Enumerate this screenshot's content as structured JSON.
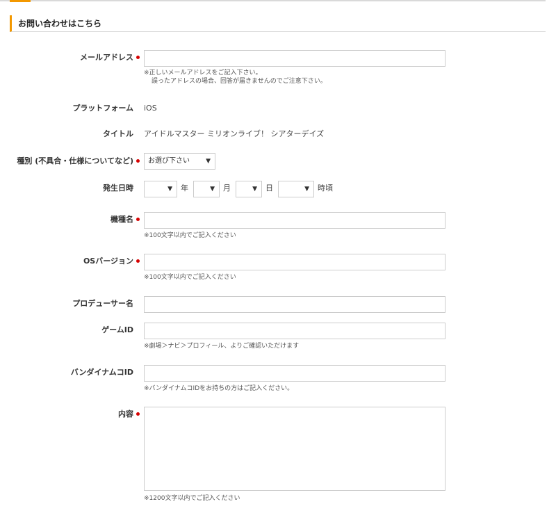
{
  "form": {
    "title": "お問い合わせはこちら",
    "email": {
      "label": "メールアドレス",
      "value": "",
      "note1": "※正しいメールアドレスをご記入下さい。",
      "note2": "誤ったアドレスの場合、回答が届きませんのでご注意下さい。"
    },
    "platform": {
      "label": "プラットフォーム",
      "value": "iOS"
    },
    "title_field": {
      "label": "タイトル",
      "value": "アイドルマスター ミリオンライブ！ シアターデイズ"
    },
    "category": {
      "label": "種別 (不具合・仕様についてなど)",
      "selected": "お選び下さい"
    },
    "occurrence": {
      "label": "発生日時",
      "year_unit": "年",
      "month_unit": "月",
      "day_unit": "日",
      "hour_unit": "時頃"
    },
    "model": {
      "label": "機種名",
      "value": "",
      "note": "※100文字以内でご記入ください"
    },
    "os_version": {
      "label": "OSバージョン",
      "value": "",
      "note": "※100文字以内でご記入ください"
    },
    "producer_name": {
      "label": "プロデューサー名",
      "value": ""
    },
    "game_id": {
      "label": "ゲームID",
      "value": "",
      "note": "※劇場＞ナビ＞プロフィール、よりご確認いただけます"
    },
    "bandai_id": {
      "label": "バンダイナムコID",
      "value": "",
      "note": "※バンダイナムコIDをお持ちの方はご記入ください。"
    },
    "content": {
      "label": "内容",
      "value": "",
      "note": "※1200文字以内でご記入ください"
    }
  },
  "colors": {
    "accent": "#f39800",
    "required": "#d60000"
  },
  "icons": {
    "dropdown": "triangle-down-icon"
  }
}
